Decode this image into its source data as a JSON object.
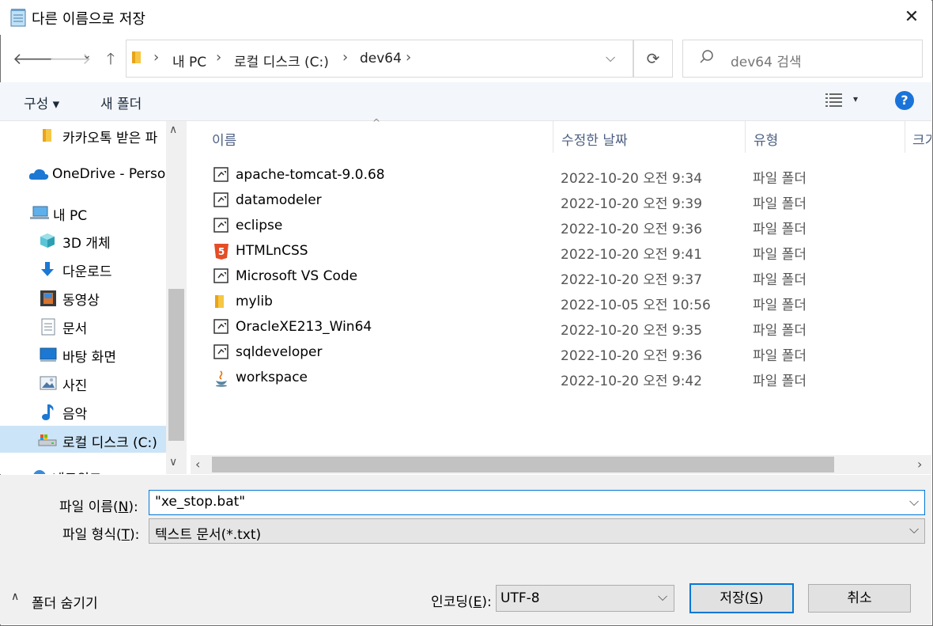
{
  "window": {
    "title": "다른 이름으로 저장",
    "close": "✕"
  },
  "address": {
    "crumbs": [
      "내 PC",
      "로컬 디스크 (C:)",
      "dev64"
    ],
    "search_placeholder": "dev64 검색"
  },
  "toolbar": {
    "organize": "구성 ▾",
    "new_folder": "새 폴더",
    "help": "?"
  },
  "nav": {
    "items": [
      {
        "label": "카카오톡 받은 파",
        "icon": "folder-icon"
      },
      {
        "label": "OneDrive - Persor",
        "icon": "cloud-icon"
      },
      {
        "label": "내 PC",
        "icon": "computer-icon"
      },
      {
        "label": "3D 개체",
        "icon": "cube-icon"
      },
      {
        "label": "다운로드",
        "icon": "download-icon"
      },
      {
        "label": "동영상",
        "icon": "film-icon"
      },
      {
        "label": "문서",
        "icon": "document-icon"
      },
      {
        "label": "바탕 화면",
        "icon": "desktop-icon"
      },
      {
        "label": "사진",
        "icon": "picture-icon"
      },
      {
        "label": "음악",
        "icon": "music-icon"
      },
      {
        "label": "로컬 디스크 (C:)",
        "icon": "drive-icon"
      },
      {
        "label": "네트워크",
        "icon": "network-icon"
      }
    ]
  },
  "columns": {
    "name": "이름",
    "date": "수정한 날짜",
    "type": "유형",
    "size": "크기"
  },
  "files": [
    {
      "name": "apache-tomcat-9.0.68",
      "date": "2022-10-20 오전 9:34",
      "type": "파일 폴더",
      "icon": "shortcut-folder-icon"
    },
    {
      "name": "datamodeler",
      "date": "2022-10-20 오전 9:39",
      "type": "파일 폴더",
      "icon": "shortcut-folder-icon"
    },
    {
      "name": "eclipse",
      "date": "2022-10-20 오전 9:36",
      "type": "파일 폴더",
      "icon": "shortcut-folder-icon"
    },
    {
      "name": "HTMLnCSS",
      "date": "2022-10-20 오전 9:41",
      "type": "파일 폴더",
      "icon": "html5-icon"
    },
    {
      "name": "Microsoft VS Code",
      "date": "2022-10-20 오전 9:37",
      "type": "파일 폴더",
      "icon": "shortcut-folder-icon"
    },
    {
      "name": "mylib",
      "date": "2022-10-05 오전 10:56",
      "type": "파일 폴더",
      "icon": "folder-icon"
    },
    {
      "name": "OracleXE213_Win64",
      "date": "2022-10-20 오전 9:35",
      "type": "파일 폴더",
      "icon": "shortcut-folder-icon"
    },
    {
      "name": "sqldeveloper",
      "date": "2022-10-20 오전 9:36",
      "type": "파일 폴더",
      "icon": "shortcut-folder-icon"
    },
    {
      "name": "workspace",
      "date": "2022-10-20 오전 9:42",
      "type": "파일 폴더",
      "icon": "java-icon"
    }
  ],
  "form": {
    "filename_label": "파일 이름(",
    "filename_key": "N",
    "filename_label_end": "):",
    "filename_value": "\"xe_stop.bat\"",
    "filetype_label": "파일 형식(",
    "filetype_key": "T",
    "filetype_label_end": "):",
    "filetype_value": "텍스트 문서(*.txt)",
    "encoding_label": "인코딩(",
    "encoding_key": "E",
    "encoding_label_end": "):",
    "encoding_value": "UTF-8",
    "hide_folders": "폴더 숨기기",
    "save": "저장(",
    "save_key": "S",
    "save_end": ")",
    "cancel": "취소"
  }
}
